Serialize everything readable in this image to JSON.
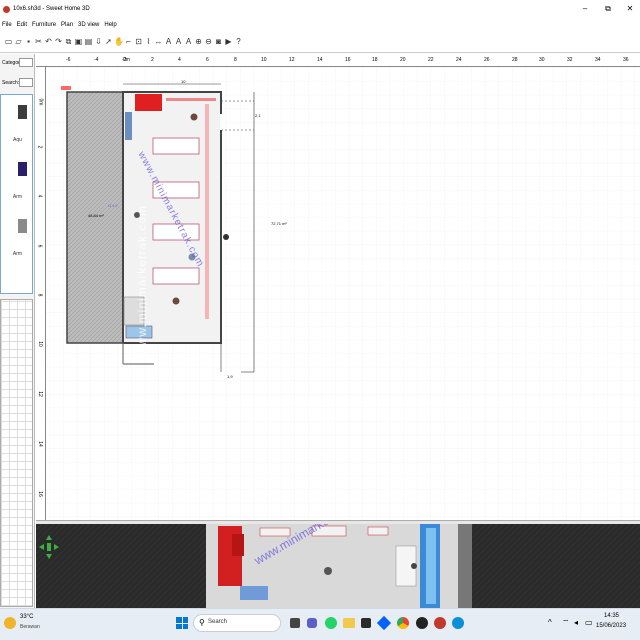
{
  "window": {
    "title": "10x6.sh3d - Sweet Home 3D",
    "minimize": "–",
    "maximize": "⧉",
    "close": "✕"
  },
  "menu": [
    "File",
    "Edit",
    "Furniture",
    "Plan",
    "3D view",
    "Help"
  ],
  "left_panel": {
    "category_label": "Category:",
    "search_label": "Search:",
    "catalog_items": [
      "Aqu",
      "Arm",
      "Arm"
    ]
  },
  "plan": {
    "h_ruler_ticks": [
      "-6",
      "-4",
      "-2",
      "0m",
      "2",
      "4",
      "6",
      "8",
      "10",
      "12",
      "14",
      "16",
      "18",
      "20",
      "22",
      "24",
      "26",
      "28",
      "30",
      "32",
      "34",
      "36"
    ],
    "v_ruler_ticks": [
      "0m",
      "2",
      "4",
      "6",
      "8",
      "10",
      "12",
      "14",
      "16"
    ],
    "room_area_left": "48,84 m²",
    "room_area_right": "72,71 m²",
    "dim_top": "10",
    "dim_side": "2,1",
    "dim_bottom": "1,9",
    "watermark_left": "www.minimarketrak.com",
    "watermark_diag": "www.minimarketrak.com",
    "label_ijo": "IJ x 2"
  },
  "taskbar": {
    "weather_temp": "33°C",
    "weather_desc": "Berawan",
    "search_placeholder": "Search",
    "time": "14:35",
    "date": "15/06/2023"
  }
}
